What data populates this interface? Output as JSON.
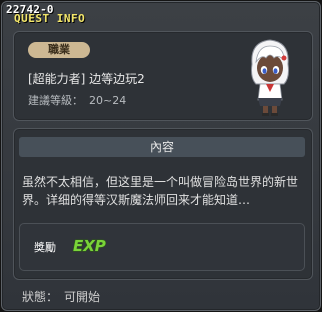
{
  "window": {
    "quest_id": "22742-0",
    "title": "QUEST INFO"
  },
  "quest": {
    "job_badge": "職業",
    "name": "[超能力者] 边等边玩2",
    "level_label": "建議等級：",
    "level_value": "20~24",
    "npc_icon": "npc-portrait-icon"
  },
  "content": {
    "header": "內容",
    "text": "虽然不太相信，但这里是一个叫做冒险岛世界的新世界。详细的得等汉斯魔法师回来才能知道…"
  },
  "reward": {
    "label": "獎勵",
    "exp_label": "EXP",
    "exp_icon": "exp-icon"
  },
  "status": {
    "label": "狀態：",
    "value": "可開始"
  },
  "colors": {
    "title": "#f3e66a",
    "exp_green": "#7ad33a",
    "badge": "#cdb893"
  }
}
